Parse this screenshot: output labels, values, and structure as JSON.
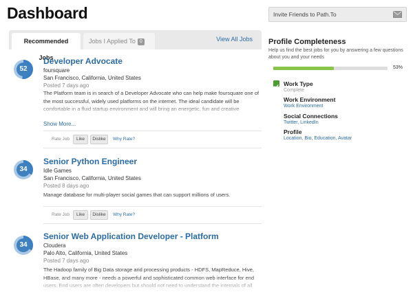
{
  "page": {
    "title": "Dashboard"
  },
  "tabs": {
    "recommended_label": "Recommended Jobs",
    "applied_label": "Jobs I Applied To",
    "applied_count": "0",
    "view_all_label": "View All Jobs"
  },
  "rate": {
    "label": "Rate Job",
    "like": "Like",
    "dislike": "Dislike",
    "why": "Why Rate?"
  },
  "jobs": [
    {
      "score": "52",
      "score_fraction": 0.52,
      "title": "Developer Advocate",
      "company": "foursquare",
      "location": "San Francisco, California, United States",
      "posted": "Posted 7 days ago",
      "description": "The Platform team is in search of a Developer Advocate who can help make foursquare one of the most successful, widely used platforms on the internet. The ideal candidate will be comfortable in a fluid startup environment and will bring an energetic, fun and creative approach to their work. To thrive as a member of foursquare team, you must embrace our exciting",
      "show_more": "Show More..."
    },
    {
      "score": "34",
      "score_fraction": 0.34,
      "title": "Senior Python Engineer",
      "company": "Idle Games",
      "location": "San Francisco, California, United States",
      "posted": "Posted 8 days ago",
      "description": "Manage database for multi-player social games that can support millions of users."
    },
    {
      "score": "34",
      "score_fraction": 0.34,
      "title": "Senior Web Application Developer - Platform",
      "company": "Cloudera",
      "location": "Palo Alto, California, United States",
      "posted": "Posted 7 days ago",
      "description": "The Hadoop family of Big Data storage and processing products - HDFS, MapReduce, Hive, HBase, and many more - needs a powerful and sophisticated common web interface for end users. End users are often developers but should not need to understand the internals of all these products to use them. Cloudera is looking for Java web developers excited about"
    }
  ],
  "sidebar": {
    "invite_label": "Invite Friends to Path.To",
    "profile": {
      "title": "Profile Completeness",
      "subtitle": "Help us find the best jobs for you by answering a few questions about you and your needs",
      "percent_label": "53%",
      "percent_value": 0.53,
      "items": [
        {
          "title": "Work Type",
          "sub": "Complete"
        },
        {
          "title": "Work Environment",
          "sub": "Work Environment"
        },
        {
          "title": "Social Connections",
          "sub": "Twitter, LinkedIn"
        },
        {
          "title": "Profile",
          "sub": "Location, Bio, Education, Avatar"
        }
      ]
    }
  },
  "colors": {
    "link": "#2a6ca8",
    "badge_ring": "#3a7fc4",
    "badge_track": "#a9c7e6",
    "progress_fill": "#8ac34a",
    "check": "#4a9d2f"
  },
  "icons": {
    "invite": "envelope-icon",
    "check": "checkmark-icon"
  }
}
